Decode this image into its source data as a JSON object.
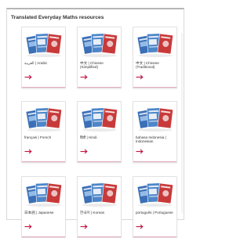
{
  "panel": {
    "title": "Translated Everyday Maths resources"
  },
  "colors": {
    "accent": "#c1123e",
    "book_blue": "#3b6fb6",
    "book_red": "#c83a3a"
  },
  "items": [
    {
      "label": "العربية | Arabic",
      "icon": "right-arrow-icon"
    },
    {
      "label": "中文 | Chinese (Simplified)",
      "icon": "right-arrow-icon"
    },
    {
      "label": "中文 | Chinese (Traditional)",
      "icon": "right-arrow-icon"
    },
    {
      "label": "français | French",
      "icon": "right-arrow-icon"
    },
    {
      "label": "हिंदी | Hindi",
      "icon": "right-arrow-icon"
    },
    {
      "label": "bahasa Indonesia | Indonesian",
      "icon": "right-arrow-icon"
    },
    {
      "label": "日本語 | Japanese",
      "icon": "right-arrow-icon"
    },
    {
      "label": "한국어 | Korean",
      "icon": "right-arrow-icon"
    },
    {
      "label": "português | Portuguese",
      "icon": "right-arrow-icon"
    }
  ]
}
